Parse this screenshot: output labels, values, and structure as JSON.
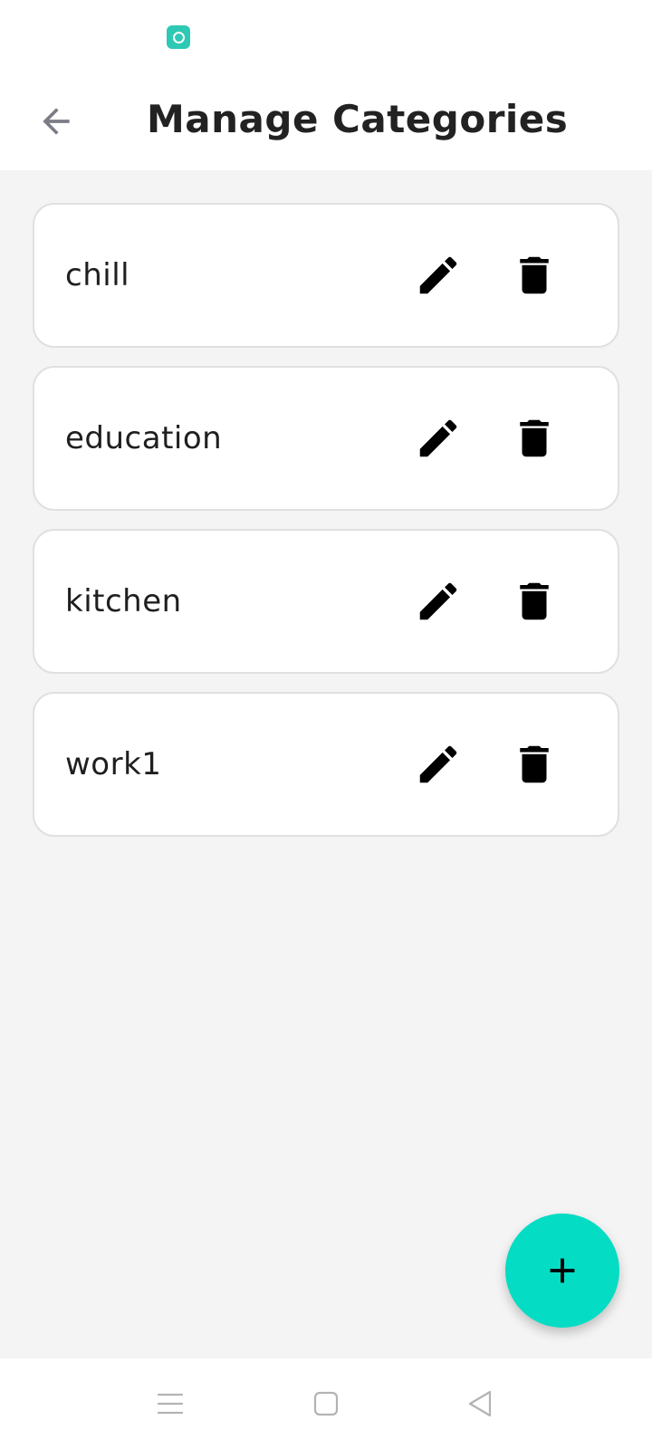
{
  "status_bar": {
    "app_icon": "teal-app-notification-icon"
  },
  "app_bar": {
    "back_icon": "arrow-left-icon",
    "title": "Manage Categories"
  },
  "categories": [
    {
      "name": "chill",
      "edit_icon": "pencil-icon",
      "delete_icon": "trash-icon"
    },
    {
      "name": "education",
      "edit_icon": "pencil-icon",
      "delete_icon": "trash-icon"
    },
    {
      "name": "kitchen",
      "edit_icon": "pencil-icon",
      "delete_icon": "trash-icon"
    },
    {
      "name": "work1",
      "edit_icon": "pencil-icon",
      "delete_icon": "trash-icon"
    }
  ],
  "fab": {
    "icon": "plus-icon",
    "color": "#05dcc4"
  },
  "nav_bar": {
    "menu_icon": "menu-lines-icon",
    "home_icon": "square-home-icon",
    "back_icon": "triangle-back-icon"
  },
  "colors": {
    "accent": "#05dcc4",
    "background": "#f4f4f4",
    "card": "#ffffff",
    "text": "#222222"
  }
}
